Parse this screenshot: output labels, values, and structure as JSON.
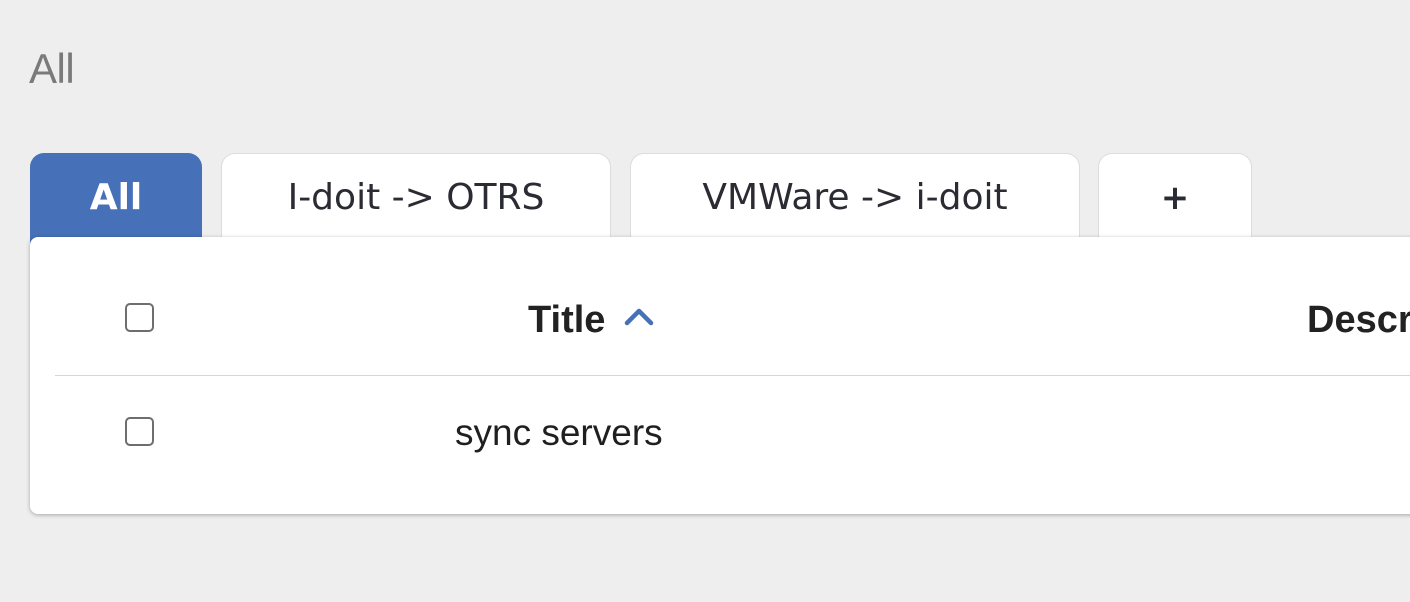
{
  "page": {
    "title": "All"
  },
  "tabs": [
    {
      "label": "All",
      "active": true
    },
    {
      "label": "I-doit -> OTRS",
      "active": false
    },
    {
      "label": "VMWare -> i-doit",
      "active": false
    },
    {
      "label": "+",
      "active": false
    }
  ],
  "table": {
    "columns": {
      "title": "Title",
      "description": "Descr"
    },
    "sort": {
      "column": "Title",
      "direction": "ascending",
      "icon": "chevron-up-icon"
    },
    "rows": [
      {
        "title": "sync servers",
        "checked": false
      }
    ]
  },
  "colors": {
    "accent": "#4670b8",
    "background": "#eeeeee"
  }
}
